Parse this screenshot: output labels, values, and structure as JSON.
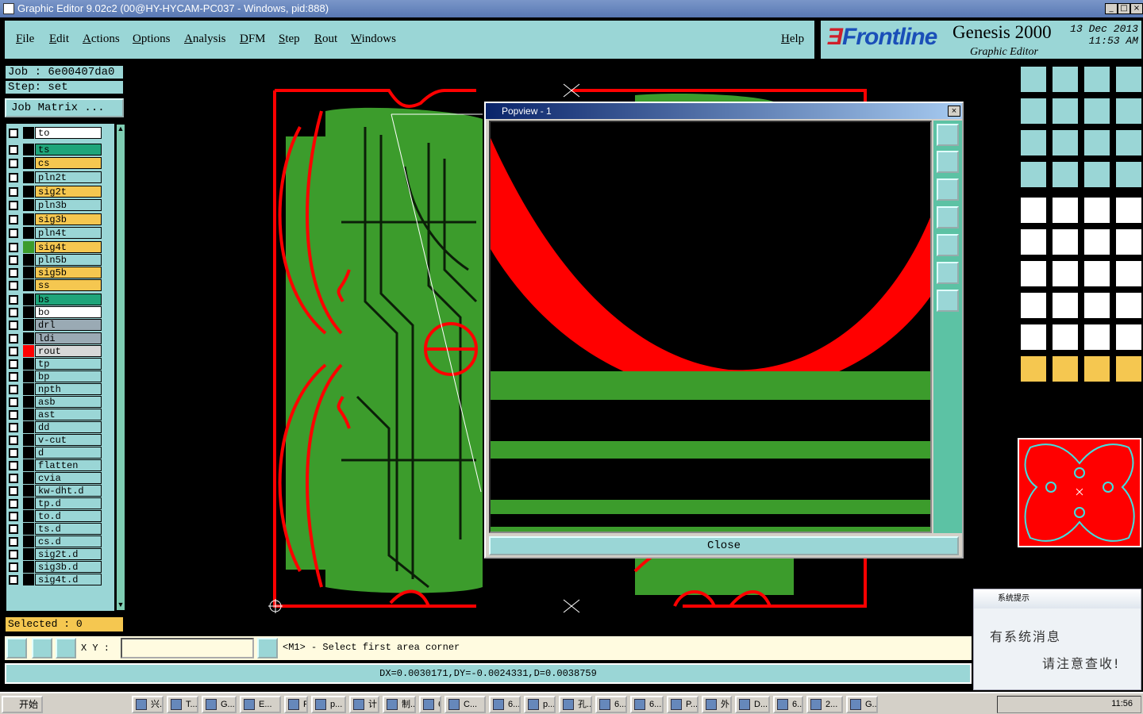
{
  "window": {
    "title": "Graphic Editor 9.02c2 (00@HY-HYCAM-PC037 - Windows, pid:888)"
  },
  "menu": [
    "File",
    "Edit",
    "Actions",
    "Options",
    "Analysis",
    "DFM",
    "Step",
    "Rout",
    "Windows"
  ],
  "help": "Help",
  "brand": {
    "logo_accent": "Ǝ",
    "logo": "Frontline",
    "product": "Genesis 2000",
    "subtitle": "Graphic Editor",
    "date": "13 Dec 2013",
    "time": "11:53 AM"
  },
  "job": {
    "job": "Job : 6e00407da0",
    "step": "Step: set",
    "matrix": "Job Matrix ..."
  },
  "layers": [
    {
      "name": "to",
      "color": "#ffffff",
      "swatch": "#000000"
    },
    {
      "name": "ts",
      "color": "#1fa57a",
      "swatch": "#000000"
    },
    {
      "name": "cs",
      "color": "#f5c750",
      "swatch": "#000000"
    },
    {
      "name": "pln2t",
      "color": "#9ad6d6",
      "swatch": "#000000"
    },
    {
      "name": "sig2t",
      "color": "#f5c750",
      "swatch": "#000000"
    },
    {
      "name": "pln3b",
      "color": "#9ad6d6",
      "swatch": "#000000"
    },
    {
      "name": "sig3b",
      "color": "#f5c750",
      "swatch": "#000000"
    },
    {
      "name": "pln4t",
      "color": "#9ad6d6",
      "swatch": "#000000"
    },
    {
      "name": "sig4t",
      "color": "#f5c750",
      "swatch": "#3c9c2c"
    },
    {
      "name": "pln5b",
      "color": "#9ad6d6",
      "swatch": "#000000"
    },
    {
      "name": "sig5b",
      "color": "#f5c750",
      "swatch": "#000000"
    },
    {
      "name": "ss",
      "color": "#f5c750",
      "swatch": "#000000"
    },
    {
      "name": "bs",
      "color": "#1fa57a",
      "swatch": "#000000"
    },
    {
      "name": "bo",
      "color": "#ffffff",
      "swatch": "#000000"
    },
    {
      "name": "drl",
      "color": "#9aaab4",
      "swatch": "#000000"
    },
    {
      "name": "ldi",
      "color": "#9aaab4",
      "swatch": "#000000"
    },
    {
      "name": "rout",
      "color": "#d8d8d8",
      "swatch": "#ff0000"
    },
    {
      "name": "tp",
      "color": "#9ad6d6",
      "swatch": "#000000"
    },
    {
      "name": "bp",
      "color": "#9ad6d6",
      "swatch": "#000000"
    },
    {
      "name": "npth",
      "color": "#9ad6d6",
      "swatch": "#000000"
    },
    {
      "name": "asb",
      "color": "#9ad6d6",
      "swatch": "#000000"
    },
    {
      "name": "ast",
      "color": "#9ad6d6",
      "swatch": "#000000"
    },
    {
      "name": "dd",
      "color": "#9ad6d6",
      "swatch": "#000000"
    },
    {
      "name": "v-cut",
      "color": "#9ad6d6",
      "swatch": "#000000"
    },
    {
      "name": "d",
      "color": "#9ad6d6",
      "swatch": "#000000"
    },
    {
      "name": "flatten",
      "color": "#9ad6d6",
      "swatch": "#000000"
    },
    {
      "name": "cvia",
      "color": "#9ad6d6",
      "swatch": "#000000"
    },
    {
      "name": "kw-dht.d",
      "color": "#9ad6d6",
      "swatch": "#000000"
    },
    {
      "name": "tp.d",
      "color": "#9ad6d6",
      "swatch": "#000000"
    },
    {
      "name": "to.d",
      "color": "#9ad6d6",
      "swatch": "#000000"
    },
    {
      "name": "ts.d",
      "color": "#9ad6d6",
      "swatch": "#000000"
    },
    {
      "name": "cs.d",
      "color": "#9ad6d6",
      "swatch": "#000000"
    },
    {
      "name": "sig2t.d",
      "color": "#9ad6d6",
      "swatch": "#000000"
    },
    {
      "name": "sig3b.d",
      "color": "#9ad6d6",
      "swatch": "#000000"
    },
    {
      "name": "sig4t.d",
      "color": "#9ad6d6",
      "swatch": "#000000"
    }
  ],
  "selected": "Selected : 0",
  "popview": {
    "title": "Popview - 1",
    "close": "Close"
  },
  "bottom": {
    "xy_label": "X Y :",
    "prompt": "<M1> - Select first area corner"
  },
  "status": "DX=0.0030171,DY=-0.0024331,D=0.0038759",
  "notify": {
    "title": "系统提示",
    "line1": "有系统消息",
    "line2": "请注意查收!"
  },
  "taskbar": {
    "start": "开始",
    "tasks": [
      "兴...",
      "T...",
      "G...",
      "E...",
      "P...",
      "p...",
      "计...",
      "制...",
      "6...",
      "C...",
      "6...",
      "p...",
      "孔...",
      "6...",
      "6...",
      "P...",
      "外...",
      "D...",
      "6...",
      "2...",
      "G..."
    ],
    "clock": "11:56"
  }
}
